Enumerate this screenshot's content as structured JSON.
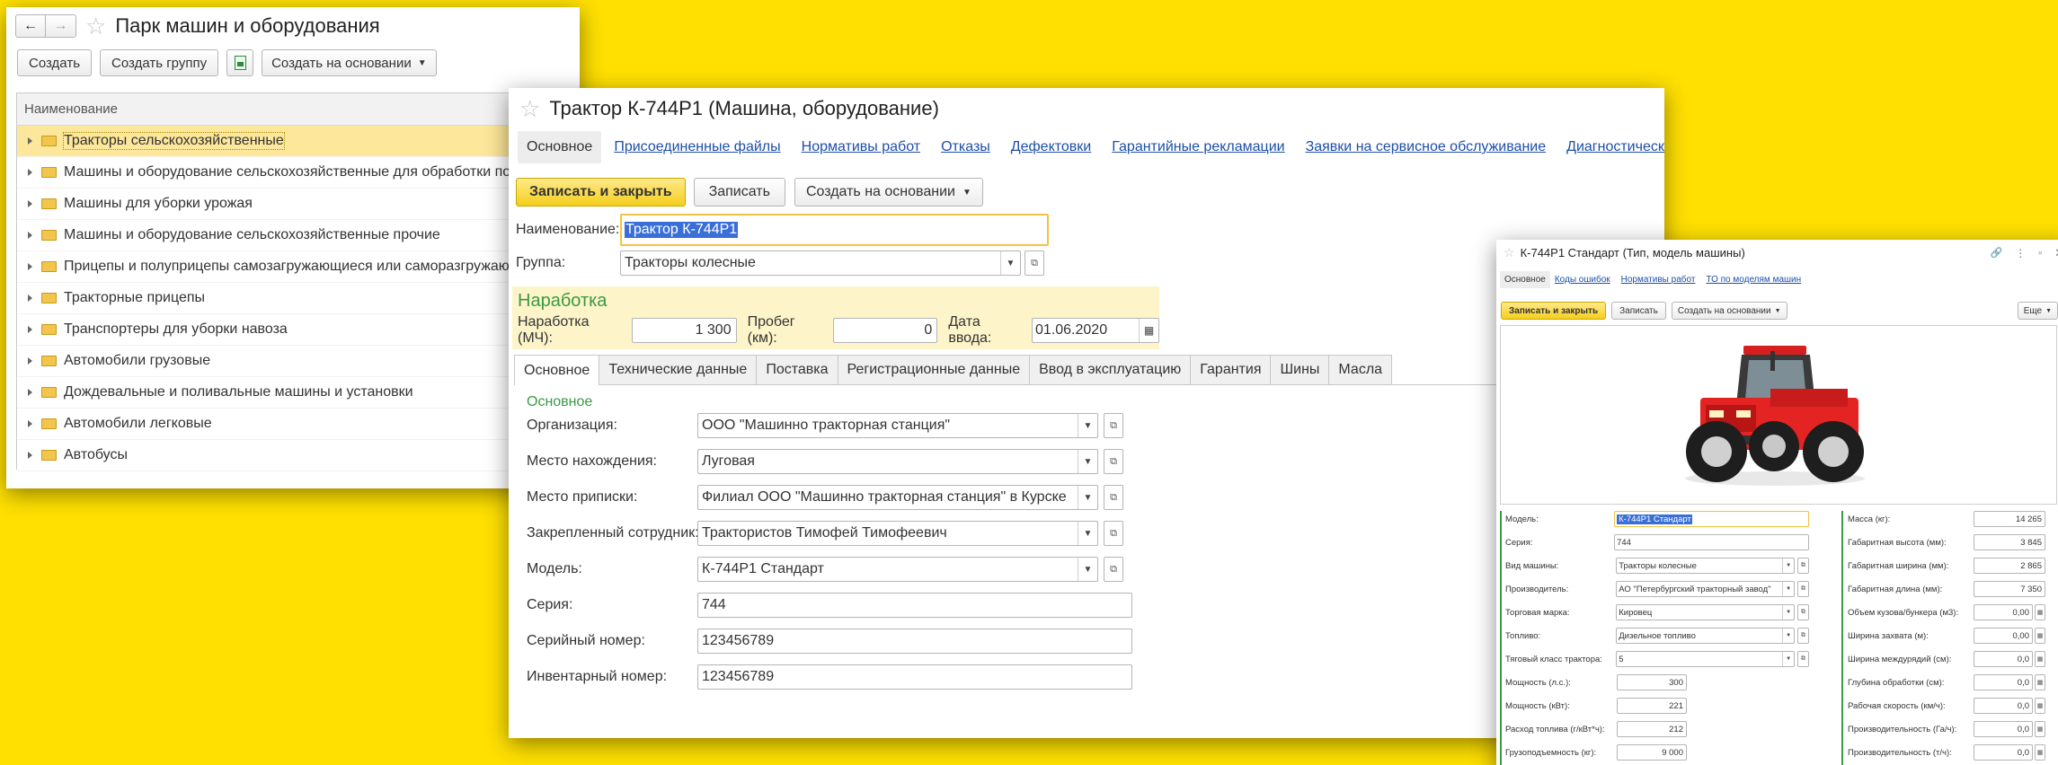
{
  "list_window": {
    "title": "Парк машин и оборудования",
    "toolbar": {
      "create": "Создать",
      "create_group": "Создать группу",
      "create_based": "Создать на основании"
    },
    "column_header": "Наименование",
    "rows": [
      "Тракторы сельскохозяйственные",
      "Машины и оборудование сельскохозяйственные для обработки почвы",
      "Машины для уборки урожая",
      "Машины и оборудование сельскохозяйственные прочие",
      "Прицепы и полуприцепы самозагружающиеся или саморазгружающиеся",
      "Тракторные прицепы",
      "Транспортеры для уборки навоза",
      "Автомобили грузовые",
      "Дождевальные и поливальные машины и установки",
      "Автомобили легковые",
      "Автобусы"
    ]
  },
  "main_window": {
    "title": "Трактор К-744Р1 (Машина, оборудование)",
    "nav_tabs": [
      "Основное",
      "Присоединенные файлы",
      "Нормативы работ",
      "Отказы",
      "Дефектовки",
      "Гарантийные рекламации",
      "Заявки на сервисное обслуживание",
      "Диагностические карты"
    ],
    "toolbar": {
      "save_close": "Записать и закрыть",
      "save": "Записать",
      "create_based": "Создать на основании"
    },
    "name_label": "Наименование:",
    "name_value": "Трактор К-744Р1",
    "group_label": "Группа:",
    "group_value": "Тракторы колесные",
    "usage_section": {
      "title": "Наработка",
      "hours_label": "Наработка (МЧ):",
      "hours_value": "1 300",
      "mileage_label": "Пробег (км):",
      "mileage_value": "0",
      "date_label": "Дата ввода:",
      "date_value": "01.06.2020"
    },
    "sub_tabs": [
      "Основное",
      "Технические данные",
      "Поставка",
      "Регистрационные данные",
      "Ввод в эксплуатацию",
      "Гарантия",
      "Шины",
      "Масла"
    ],
    "section_title": "Основное",
    "fields": [
      {
        "label": "Организация:",
        "value": "ООО \"Машинно тракторная станция\""
      },
      {
        "label": "Место нахождения:",
        "value": "Луговая"
      },
      {
        "label": "Место приписки:",
        "value": "Филиал ООО \"Машинно тракторная станция\" в Курске"
      },
      {
        "label": "Закрепленный сотрудник:",
        "value": "Трактористов Тимофей Тимофеевич"
      },
      {
        "label": "Модель:",
        "value": "К-744Р1 Стандарт"
      },
      {
        "label": "Серия:",
        "value": "744"
      },
      {
        "label": "Серийный номер:",
        "value": "123456789"
      },
      {
        "label": "Инвентарный номер:",
        "value": "123456789"
      }
    ]
  },
  "model_window": {
    "title": "К-744Р1 Стандарт (Тип, модель машины)",
    "nav_tabs": [
      "Основное",
      "Коды ошибок",
      "Нормативы работ",
      "ТО по моделям машин"
    ],
    "toolbar": {
      "save_close": "Записать и закрыть",
      "save": "Записать",
      "create_based": "Создать на основании",
      "more": "Еще"
    },
    "image_alt": "tractor-image",
    "left_fields": [
      {
        "label": "Модель:",
        "value": "К-744Р1 Стандарт"
      },
      {
        "label": "Серия:",
        "value": "744"
      },
      {
        "label": "Вид машины:",
        "value": "Тракторы колесные"
      },
      {
        "label": "Производитель:",
        "value": "АО \"Петербургский тракторный завод\""
      },
      {
        "label": "Торговая марка:",
        "value": "Кировец"
      },
      {
        "label": "Топливо:",
        "value": "Дизельное топливо"
      },
      {
        "label": "Тяговый класс трактора:",
        "value": "5"
      },
      {
        "label": "Мощность (л.с.):",
        "value": "300"
      },
      {
        "label": "Мощность (кВт):",
        "value": "221"
      },
      {
        "label": "Расход топлива (г/кВт*ч):",
        "value": "212"
      },
      {
        "label": "Грузоподъемность (кг):",
        "value": "9 000"
      }
    ],
    "right_fields": [
      {
        "label": "Масса (кг):",
        "value": "14 265"
      },
      {
        "label": "Габаритная высота (мм):",
        "value": "3 845"
      },
      {
        "label": "Габаритная ширина (мм):",
        "value": "2 865"
      },
      {
        "label": "Габаритная длина (мм):",
        "value": "7 350"
      },
      {
        "label": "Объем кузова/бункера (м3):",
        "value": "0,00"
      },
      {
        "label": "Ширина захвата (м):",
        "value": "0,00"
      },
      {
        "label": "Ширина междурядий (см):",
        "value": "0,0"
      },
      {
        "label": "Глубина обработки (см):",
        "value": "0,0"
      },
      {
        "label": "Рабочая скорость (км/ч):",
        "value": "0,0"
      },
      {
        "label": "Производительность (Га/ч):",
        "value": "0,0"
      },
      {
        "label": "Производительность (т/ч):",
        "value": "0,0"
      }
    ]
  }
}
